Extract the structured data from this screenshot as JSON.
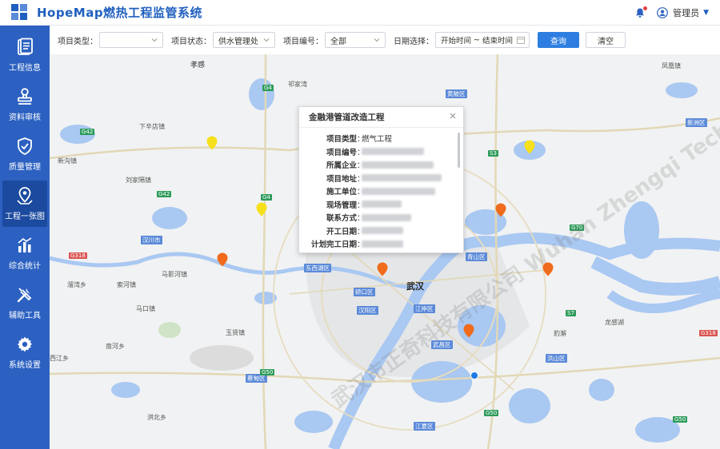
{
  "app": {
    "title": "HopeMap燃热工程监管系统"
  },
  "header": {
    "user_name": "管理员"
  },
  "sidebar": {
    "items": [
      {
        "label": "工程信息",
        "icon": "document-list-icon"
      },
      {
        "label": "资料审核",
        "icon": "stamp-icon"
      },
      {
        "label": "质量管理",
        "icon": "shield-check-icon"
      },
      {
        "label": "工程一张图",
        "icon": "map-pin-icon",
        "active": true
      },
      {
        "label": "综合统计",
        "icon": "bar-chart-icon"
      },
      {
        "label": "辅助工具",
        "icon": "tools-icon"
      },
      {
        "label": "系统设置",
        "icon": "gear-icon"
      }
    ]
  },
  "filters": {
    "project_type_label": "项目类型：",
    "project_type_value": "",
    "project_status_label": "项目状态：",
    "project_status_value": "供水管理处",
    "project_code_label": "项目编号：",
    "project_code_value": "全部",
    "date_label": "日期选择：",
    "date_start": "开始时间",
    "date_sep": "~",
    "date_end": "结束时间",
    "query_button": "查询",
    "clear_button": "清空"
  },
  "map": {
    "city": "武汉",
    "places": [
      "孝感",
      "下辛店镇",
      "刘家隔镇",
      "马影河镇",
      "新沟镇",
      "溜湾乡",
      "索河镇",
      "马口镇",
      "汉川市",
      "玉贤镇",
      "蔡甸区",
      "南河乡",
      "西江乡",
      "洪北乡",
      "豹澥",
      "龙感湖",
      "凤凰镇",
      "祁家湾"
    ],
    "districts": [
      "东西湖区",
      "硚口区",
      "汉阳区",
      "江岸区",
      "武昌区",
      "洪山区",
      "江夏区",
      "黄陂区",
      "青山区",
      "新洲区"
    ],
    "highways": [
      "G42",
      "G4",
      "G50",
      "S3",
      "G70",
      "S7",
      "G318"
    ],
    "watermark": "武汉市正奇科技有限公司 Wuhan Zhengqi Technology Co.,Ltd.",
    "colors": {
      "pin_orange": "#f06b1c",
      "pin_yellow": "#f5e01b",
      "dot_blue": "#1e7ae6",
      "water": "#a9c8f2"
    }
  },
  "popup": {
    "title": "金融港管道改造工程",
    "rows": [
      {
        "key": "项目类型",
        "value": "燃气工程"
      },
      {
        "key": "项目编号",
        "value": ""
      },
      {
        "key": "所属企业",
        "value": ""
      },
      {
        "key": "项目地址",
        "value": ""
      },
      {
        "key": "施工单位",
        "value": ""
      },
      {
        "key": "现场管理",
        "value": ""
      },
      {
        "key": "联系方式",
        "value": ""
      },
      {
        "key": "开工日期",
        "value": ""
      },
      {
        "key": "计划完工日期",
        "value": ""
      }
    ]
  }
}
